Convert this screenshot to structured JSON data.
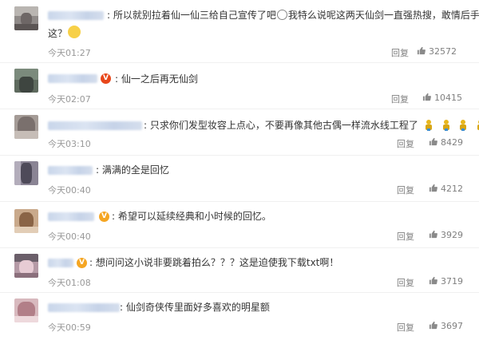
{
  "comments": [
    {
      "text": ":  所以就别拉着仙一仙三给自己宣传了吧",
      "text_after": "我特么说呢这两天仙剑一直强热搜，敢情后手在",
      "continuation": "这？",
      "time": "今天01:27",
      "reply": "回复",
      "likes": "32572"
    },
    {
      "text": ":  仙一之后再无仙剑",
      "time": "今天02:07",
      "reply": "回复",
      "likes": "10415"
    },
    {
      "text": ":  只求你们发型妆容上点心，不要再像其他古偶一样流水线工程了",
      "time": "今天03:10",
      "reply": "回复",
      "likes": "8429"
    },
    {
      "text": ":  满满的全是回忆",
      "time": "今天00:40",
      "reply": "回复",
      "likes": "4212"
    },
    {
      "text": ":  希望可以延续经典和小时候的回忆。",
      "time": "今天00:40",
      "reply": "回复",
      "likes": "3929"
    },
    {
      "text": ":  想问问这小说非要跳着拍么？？？这是迫使我下载txt啊！",
      "time": "今天01:08",
      "reply": "回复",
      "likes": "3719"
    },
    {
      "text": ":  仙剑奇侠传里面好多喜欢的明星额",
      "time": "今天00:59",
      "reply": "回复",
      "likes": "3697"
    }
  ],
  "badges": {
    "verified": "V"
  },
  "colors": {
    "username_blur": "#c9d6ea",
    "badge_orange": "#f5a623",
    "badge_red": "#e8471b",
    "thumb": "#8a8a8a"
  },
  "icons": {
    "like": "thumb-up-icon",
    "emoji": "smile-emoji",
    "figure": "gold-figure-emoji"
  }
}
